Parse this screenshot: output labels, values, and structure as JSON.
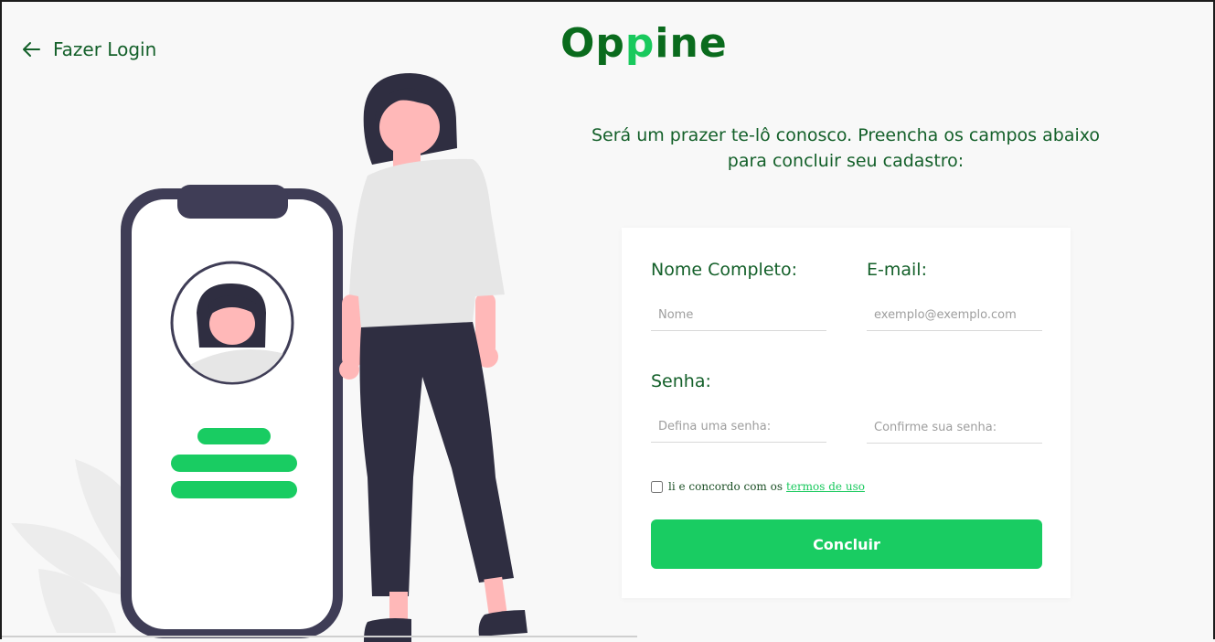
{
  "nav": {
    "back_label": "Fazer Login"
  },
  "brand": {
    "part1": "Op",
    "part2": "p",
    "part3": "ine",
    "dark_color": "#0a6b1d",
    "light_color": "#19c95d"
  },
  "intro": "Será um prazer te-lô conosco. Preencha os campos abaixo para concluir seu cadastro:",
  "form": {
    "name_label": "Nome Completo:",
    "name_placeholder": "Nome",
    "email_label": "E-mail:",
    "email_placeholder": "exemplo@exemplo.com",
    "password_label": "Senha:",
    "password_placeholder": "Defina uma senha:",
    "confirm_placeholder": "Confirme sua senha:",
    "terms_text": "li e concordo com os",
    "terms_link": "termos de uso",
    "terms_checked": false,
    "submit_label": "Concluir"
  },
  "colors": {
    "accent": "#19cc62",
    "text_green": "#14602a",
    "background": "#f8f8f8"
  },
  "icons": {
    "back": "arrow-left-icon"
  }
}
